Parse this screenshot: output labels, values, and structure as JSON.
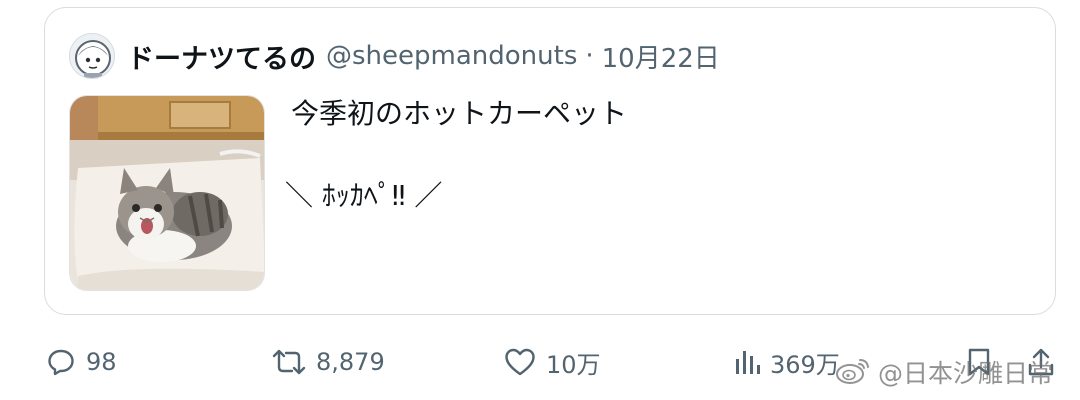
{
  "tweet": {
    "display_name": "ドーナツてるの",
    "handle": "@sheepmandonuts",
    "separator": "·",
    "date": "10月22日",
    "text_line1": "今季初のホットカーペット",
    "text_line2": "＼ ﾎｯｶﾍﾟ‼ ／",
    "media_alt": "cat sitting on a white heated carpet"
  },
  "actions": {
    "reply_count": "98",
    "retweet_count": "8,879",
    "like_count": "10万",
    "view_count": "369万"
  },
  "icons": {
    "reply": "comment-bubble-icon",
    "retweet": "retweet-icon",
    "like": "heart-icon",
    "views": "bar-chart-icon",
    "bookmark": "bookmark-icon",
    "share": "share-icon"
  },
  "watermark": {
    "text": "@日本沙雕日常"
  },
  "colors": {
    "text_primary": "#0f1419",
    "text_secondary": "#536471",
    "border": "#d9dde0"
  }
}
